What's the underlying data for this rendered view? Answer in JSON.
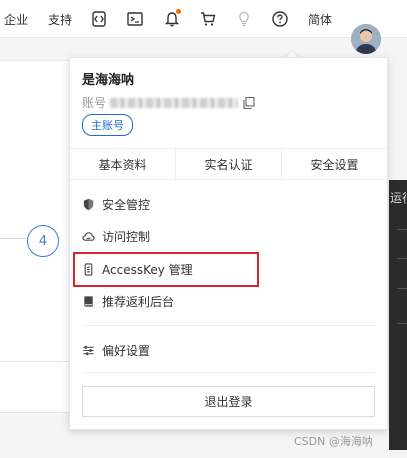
{
  "topbar": {
    "enterprise_label": "企业",
    "support_label": "支持",
    "lang_label": "简体",
    "icons": [
      "code-icon",
      "terminal-icon",
      "bell-icon",
      "cart-icon",
      "lightbulb-icon",
      "help-icon"
    ],
    "notification_dot_color": "#ff6a00"
  },
  "background": {
    "step_number": "4",
    "side_label": "运行"
  },
  "account_menu": {
    "user_name": "是海海呐",
    "account_label": "账号",
    "main_account_badge": "主账号",
    "tabs": [
      "基本资料",
      "实名认证",
      "安全设置"
    ],
    "items": [
      {
        "label": "安全管控",
        "icon": "shield-icon"
      },
      {
        "label": "访问控制",
        "icon": "cloud-icon"
      },
      {
        "label": "AccessKey 管理",
        "icon": "key-icon"
      },
      {
        "label": "推荐返利后台",
        "icon": "book-icon"
      },
      {
        "label": "偏好设置",
        "icon": "sliders-icon"
      }
    ],
    "logout_label": "退出登录",
    "highlight_color": "#d9232e",
    "accent_color": "#1f6fd1"
  },
  "watermark": "CSDN @海海呐"
}
